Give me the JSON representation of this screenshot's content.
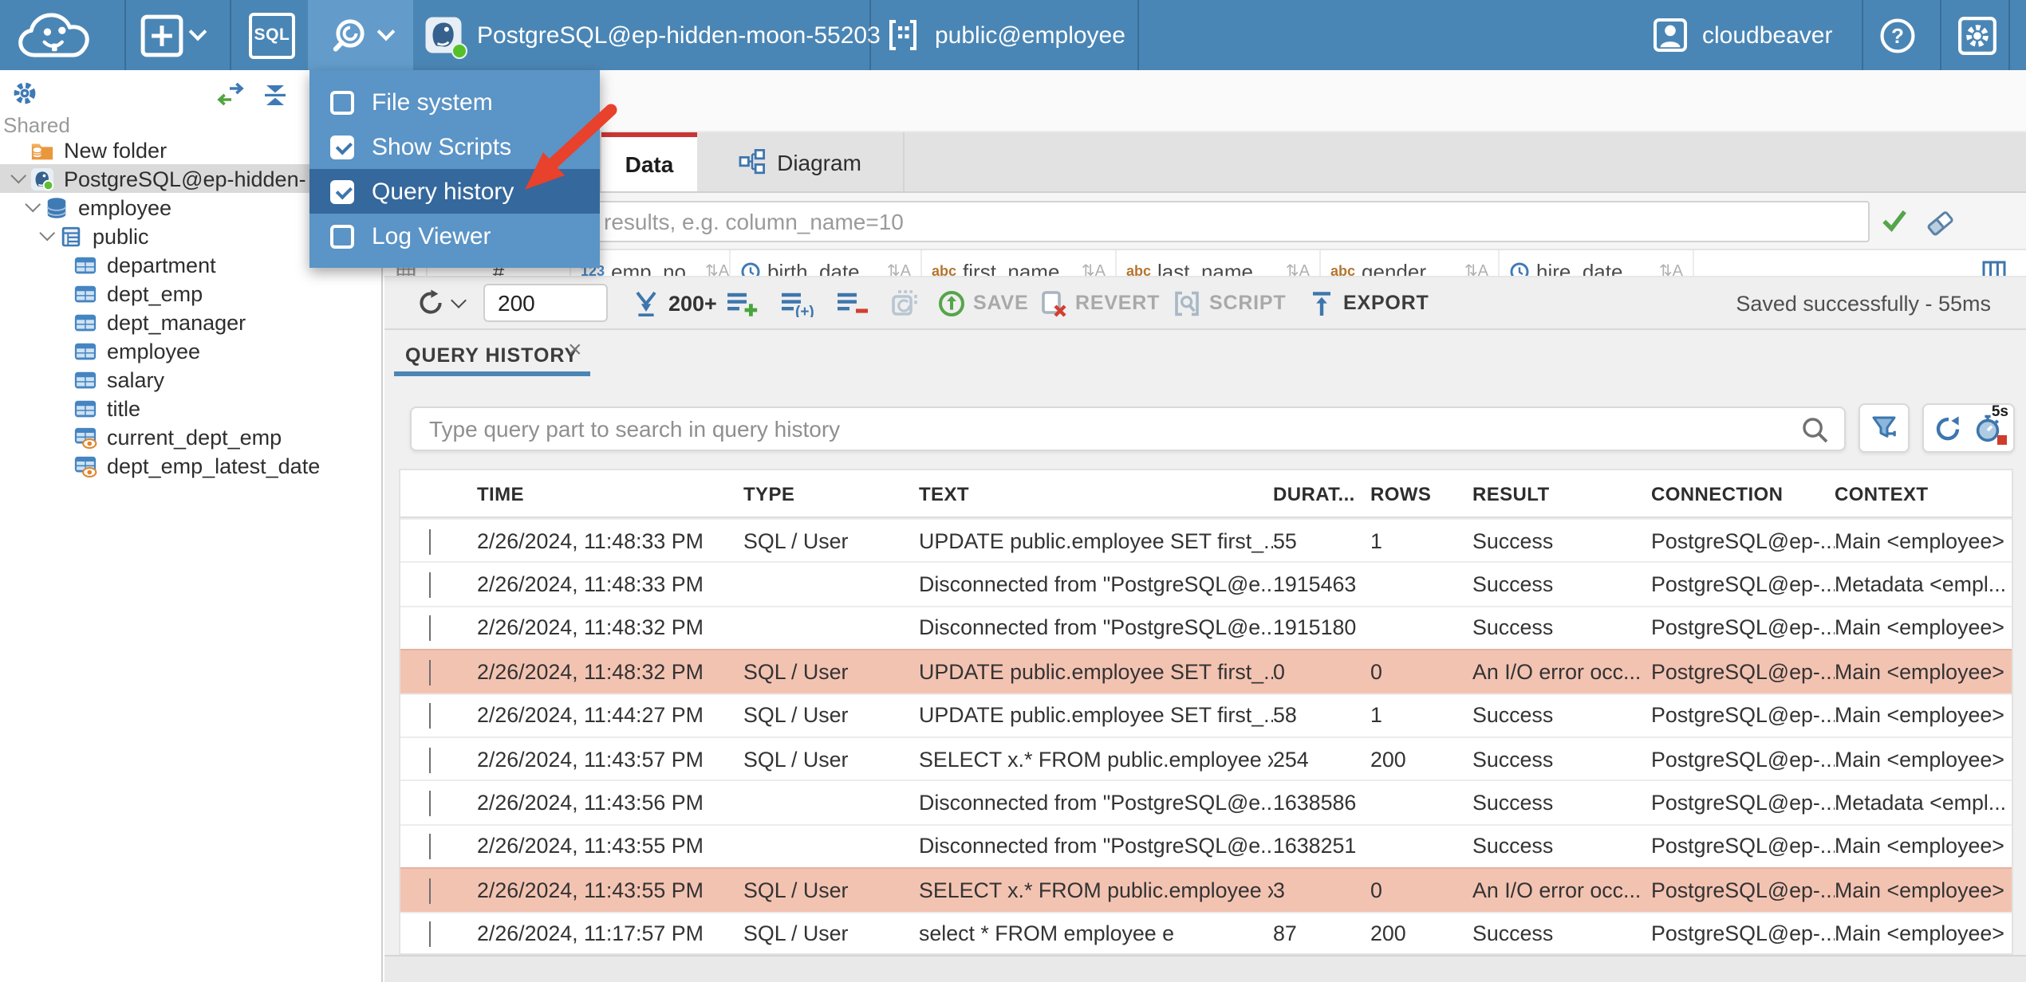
{
  "topbar": {
    "sql_button": "SQL",
    "connection_label": "PostgreSQL@ep-hidden-moon-55203",
    "schema_label": "public@employee",
    "user_label": "cloudbeaver"
  },
  "tools_menu": {
    "items": [
      {
        "label": "File system",
        "checked": false,
        "highlighted": false
      },
      {
        "label": "Show Scripts",
        "checked": true,
        "highlighted": false
      },
      {
        "label": "Query history",
        "checked": true,
        "highlighted": true
      },
      {
        "label": "Log Viewer",
        "checked": false,
        "highlighted": false
      }
    ]
  },
  "sidebar": {
    "section_label": "Shared",
    "tree": [
      {
        "label": "New folder",
        "icon": "folder",
        "depth": 0,
        "expanded": false,
        "selected": false
      },
      {
        "label": "PostgreSQL@ep-hidden-",
        "icon": "postgres",
        "depth": 0,
        "expanded": true,
        "selected": true
      },
      {
        "label": "employee",
        "icon": "database",
        "depth": 1,
        "expanded": true,
        "selected": false
      },
      {
        "label": "public",
        "icon": "schema",
        "depth": 2,
        "expanded": true,
        "selected": false
      },
      {
        "label": "department",
        "icon": "table",
        "depth": 3,
        "expanded": false,
        "selected": false
      },
      {
        "label": "dept_emp",
        "icon": "table",
        "depth": 3,
        "expanded": false,
        "selected": false
      },
      {
        "label": "dept_manager",
        "icon": "table",
        "depth": 3,
        "expanded": false,
        "selected": false
      },
      {
        "label": "employee",
        "icon": "table",
        "depth": 3,
        "expanded": false,
        "selected": false
      },
      {
        "label": "salary",
        "icon": "table",
        "depth": 3,
        "expanded": false,
        "selected": false
      },
      {
        "label": "title",
        "icon": "table",
        "depth": 3,
        "expanded": false,
        "selected": false
      },
      {
        "label": "current_dept_emp",
        "icon": "view",
        "depth": 3,
        "expanded": false,
        "selected": false
      },
      {
        "label": "dept_emp_latest_date",
        "icon": "view",
        "depth": 3,
        "expanded": false,
        "selected": false
      }
    ]
  },
  "editor": {
    "tabs": [
      {
        "label": "Data",
        "active": true
      },
      {
        "label": "Diagram",
        "active": false
      }
    ],
    "filter_placeholder": "expression to filter results, e.g. column_name=10",
    "grid_columns": [
      {
        "type": "corner",
        "label": ""
      },
      {
        "type": "rownum",
        "label": "#"
      },
      {
        "type": "number",
        "prefix": "123",
        "label": "emp_no"
      },
      {
        "type": "date",
        "label": "birth_date"
      },
      {
        "type": "string",
        "prefix": "abc",
        "label": "first_name"
      },
      {
        "type": "string",
        "prefix": "abc",
        "label": "last_name"
      },
      {
        "type": "string",
        "prefix": "abc",
        "label": "gender"
      },
      {
        "type": "date",
        "label": "hire_date"
      }
    ],
    "sort_glyph": "⇅A",
    "toolbar": {
      "row_limit_value": "200",
      "fetch_label": "200+",
      "save_label": "SAVE",
      "revert_label": "REVERT",
      "script_label": "SCRIPT",
      "export_label": "EXPORT",
      "status_text": "Saved successfully - 55ms"
    }
  },
  "query_history": {
    "tab_label": "QUERY HISTORY",
    "search_placeholder": "Type query part to search in query history",
    "auto_refresh_interval": "5s",
    "columns": [
      "TIME",
      "TYPE",
      "TEXT",
      "DURAT...",
      "ROWS",
      "RESULT",
      "CONNECTION",
      "CONTEXT"
    ],
    "rows": [
      {
        "time": "2/26/2024, 11:48:33 PM",
        "type": "SQL / User",
        "text": "UPDATE public.employee SET first_...",
        "duration": "55",
        "rows": "1",
        "result": "Success",
        "connection": "PostgreSQL@ep-...",
        "context": "Main <employee>",
        "error": false
      },
      {
        "time": "2/26/2024, 11:48:33 PM",
        "type": "",
        "text": "Disconnected from \"PostgreSQL@e...",
        "duration": "1915463",
        "rows": "",
        "result": "Success",
        "connection": "PostgreSQL@ep-...",
        "context": "Metadata <empl...",
        "error": false
      },
      {
        "time": "2/26/2024, 11:48:32 PM",
        "type": "",
        "text": "Disconnected from \"PostgreSQL@e...",
        "duration": "1915180",
        "rows": "",
        "result": "Success",
        "connection": "PostgreSQL@ep-...",
        "context": "Main <employee>",
        "error": false
      },
      {
        "time": "2/26/2024, 11:48:32 PM",
        "type": "SQL / User",
        "text": "UPDATE public.employee SET first_...",
        "duration": "0",
        "rows": "0",
        "result": "An I/O error occ...",
        "connection": "PostgreSQL@ep-...",
        "context": "Main <employee>",
        "error": true
      },
      {
        "time": "2/26/2024, 11:44:27 PM",
        "type": "SQL / User",
        "text": "UPDATE public.employee SET first_...",
        "duration": "58",
        "rows": "1",
        "result": "Success",
        "connection": "PostgreSQL@ep-...",
        "context": "Main <employee>",
        "error": false
      },
      {
        "time": "2/26/2024, 11:43:57 PM",
        "type": "SQL / User",
        "text": "SELECT x.* FROM public.employee x",
        "duration": "254",
        "rows": "200",
        "result": "Success",
        "connection": "PostgreSQL@ep-...",
        "context": "Main <employee>",
        "error": false
      },
      {
        "time": "2/26/2024, 11:43:56 PM",
        "type": "",
        "text": "Disconnected from \"PostgreSQL@e...",
        "duration": "1638586",
        "rows": "",
        "result": "Success",
        "connection": "PostgreSQL@ep-...",
        "context": "Metadata <empl...",
        "error": false
      },
      {
        "time": "2/26/2024, 11:43:55 PM",
        "type": "",
        "text": "Disconnected from \"PostgreSQL@e...",
        "duration": "1638251",
        "rows": "",
        "result": "Success",
        "connection": "PostgreSQL@ep-...",
        "context": "Main <employee>",
        "error": false
      },
      {
        "time": "2/26/2024, 11:43:55 PM",
        "type": "SQL / User",
        "text": "SELECT x.* FROM public.employee x",
        "duration": "3",
        "rows": "0",
        "result": "An I/O error occ...",
        "connection": "PostgreSQL@ep-...",
        "context": "Main <employee>",
        "error": true
      },
      {
        "time": "2/26/2024, 11:17:57 PM",
        "type": "SQL / User",
        "text": "select * FROM employee e",
        "duration": "87",
        "rows": "200",
        "result": "Success",
        "connection": "PostgreSQL@ep-...",
        "context": "Main <employee>",
        "error": false
      }
    ]
  },
  "colors": {
    "topbar": "#4a86b5",
    "menu": "#5b94c6",
    "menu_highlight": "#35689c",
    "accent_blue": "#3d76ad",
    "active_tab_border": "#c93434",
    "error_row": "#f3c3b2",
    "status_green": "#56c029",
    "annotation_arrow": "#e8412c"
  }
}
